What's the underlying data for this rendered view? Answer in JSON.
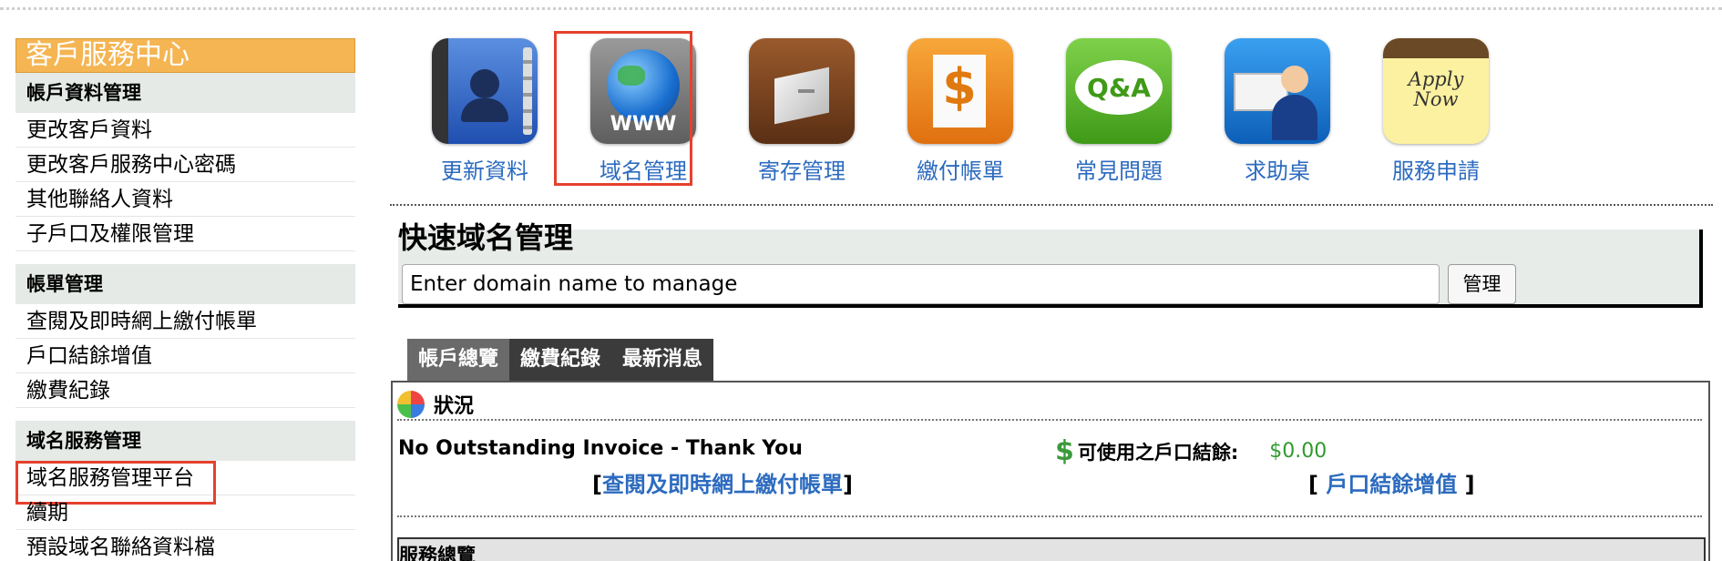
{
  "sidebar": {
    "title": "客戶服務中心",
    "groups": [
      {
        "label": "帳戶資料管理",
        "items": [
          "更改客戶資料",
          "更改客戶服務中心密碼",
          "其他聯絡人資料",
          "子戶口及權限管理"
        ]
      },
      {
        "label": "帳單管理",
        "items": [
          "查閱及即時網上繳付帳單",
          "戶口結餘增值",
          "繳費紀錄"
        ]
      },
      {
        "label": "域名服務管理",
        "items": [
          "域名服務管理平台",
          "續期",
          "預設域名聯絡資料檔"
        ]
      }
    ]
  },
  "icons": [
    {
      "label": "更新資料",
      "icon": "contacts-icon"
    },
    {
      "label": "域名管理",
      "icon": "www-globe-icon"
    },
    {
      "label": "寄存管理",
      "icon": "storage-box-icon"
    },
    {
      "label": "繳付帳單",
      "icon": "invoice-dollar-icon"
    },
    {
      "label": "常見問題",
      "icon": "qa-icon"
    },
    {
      "label": "求助桌",
      "icon": "helpdesk-icon"
    },
    {
      "label": "服務申請",
      "icon": "apply-now-icon",
      "text": "Apply Now"
    }
  ],
  "globe_text": "WWW",
  "qa_text": "Q&A",
  "quick_domain": {
    "title": "快速域名管理",
    "input_value": "Enter domain name to manage",
    "button": "管理"
  },
  "tabs": [
    "帳戶總覽",
    "繳費紀錄",
    "最新消息"
  ],
  "status": {
    "label": "狀況",
    "no_invoice": "No Outstanding Invoice - Thank You",
    "invoice_link": "查閱及即時網上繳付帳單",
    "balance_label": "可使用之戶口結餘:",
    "balance_value": "$0.00",
    "topup_link": "戶口結餘增值"
  },
  "service_overview": "服務總覽",
  "colors": {
    "accent_orange": "#f4b552",
    "link_blue": "#2c6bbf",
    "highlight_red": "#e5412d",
    "money_green": "#2f9a2f"
  }
}
